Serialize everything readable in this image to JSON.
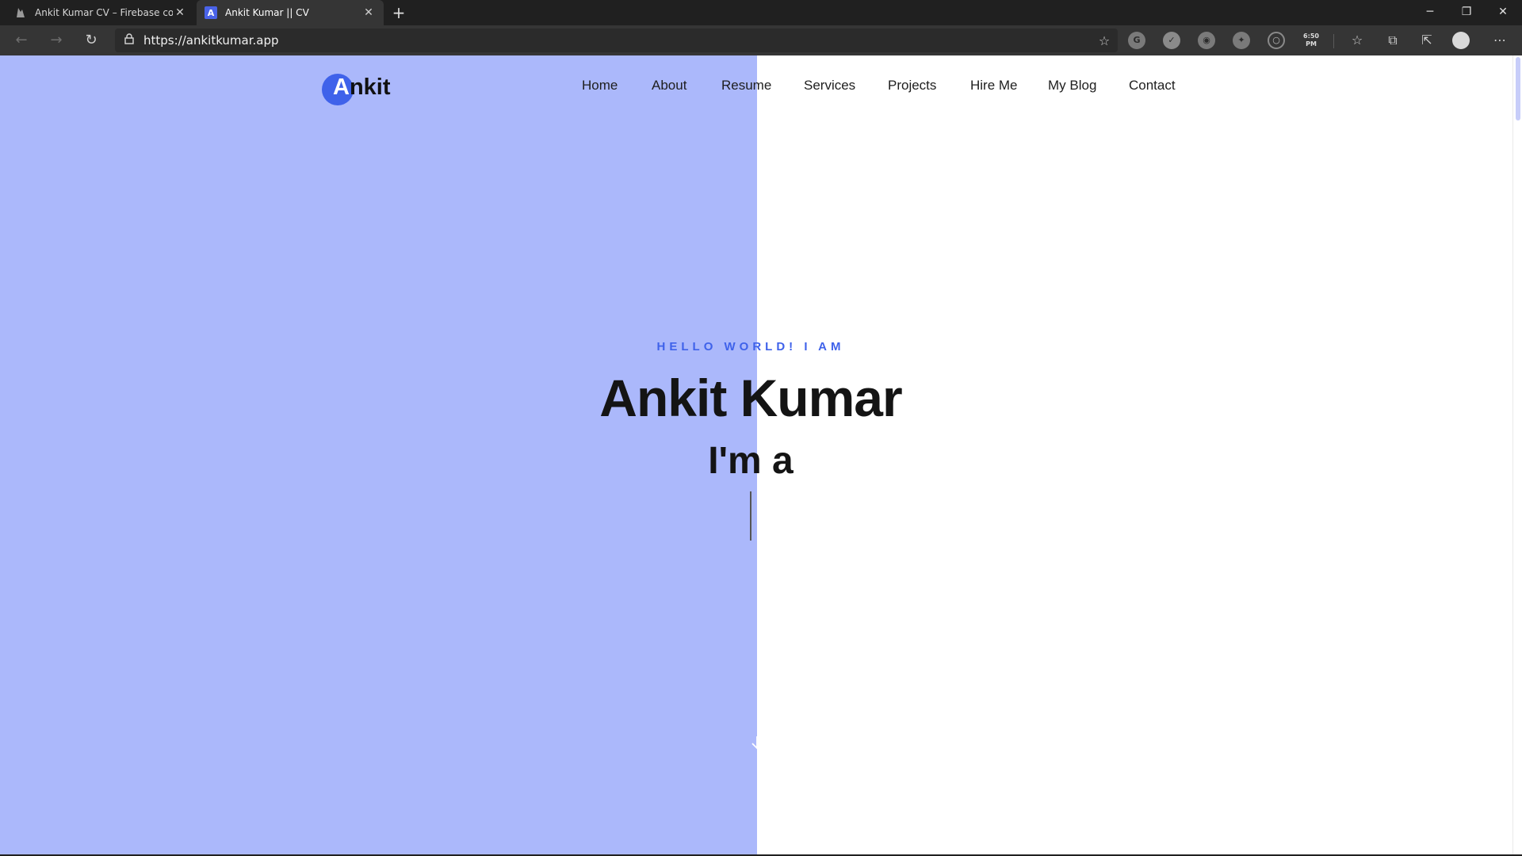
{
  "browser": {
    "tabs": [
      {
        "title": "Ankit Kumar CV – Firebase console",
        "favicon": "firebase-icon",
        "active": false
      },
      {
        "title": "Ankit Kumar || CV",
        "favicon_letter": "A",
        "active": true
      }
    ],
    "address": "https://ankitkumar.app",
    "extension_clock": {
      "time": "6:50",
      "ampm": "PM"
    }
  },
  "site": {
    "logo": {
      "first_letter": "A",
      "rest": "nkit"
    },
    "nav": [
      "Home",
      "About",
      "Resume",
      "Services",
      "Projects",
      "Hire Me",
      "My Blog",
      "Contact"
    ],
    "hero": {
      "greeting": "HELLO WORLD! I AM",
      "name": "Ankit Kumar",
      "role_prefix": "I'm a"
    }
  },
  "colors": {
    "accent": "#3f62ea",
    "panel": "#abb8fb",
    "text": "#141414"
  }
}
